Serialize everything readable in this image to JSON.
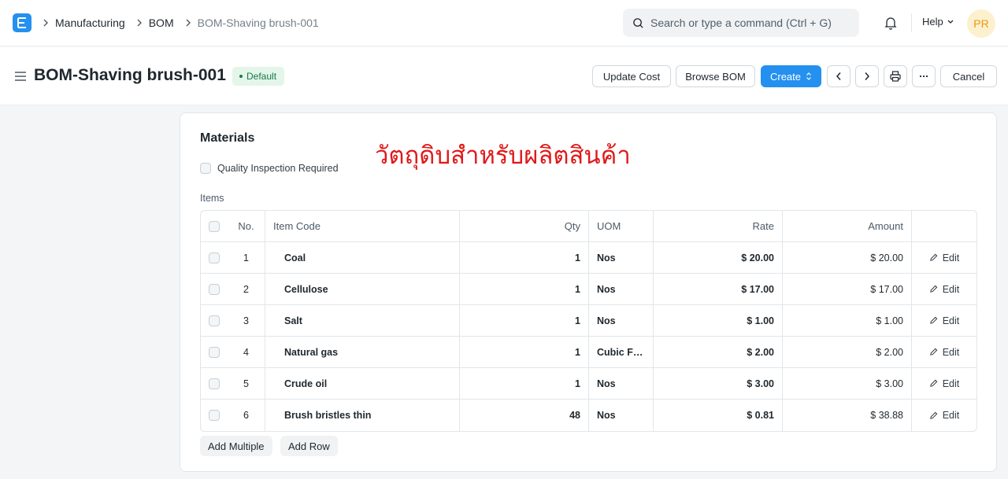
{
  "breadcrumbs": [
    "Manufacturing",
    "BOM",
    "BOM-Shaving brush-001"
  ],
  "search": {
    "placeholder": "Search or type a command (Ctrl + G)"
  },
  "help_label": "Help",
  "avatar_initials": "PR",
  "header": {
    "title": "BOM-Shaving brush-001",
    "status_badge": "Default",
    "buttons": {
      "update_cost": "Update Cost",
      "browse_bom": "Browse BOM",
      "create": "Create",
      "cancel": "Cancel"
    }
  },
  "materials": {
    "section_title": "Materials",
    "annotation": "วัตถุดิบสำหรับผลิตสินค้า",
    "quality_inspection_label": "Quality Inspection Required",
    "items_label": "Items",
    "columns": [
      "No.",
      "Item Code",
      "Qty",
      "UOM",
      "Rate",
      "Amount"
    ],
    "edit_label": "Edit",
    "rows": [
      {
        "no": "1",
        "item_code": "Coal",
        "qty": "1",
        "uom": "Nos",
        "rate": "$ 20.00",
        "amount": "$ 20.00"
      },
      {
        "no": "2",
        "item_code": "Cellulose",
        "qty": "1",
        "uom": "Nos",
        "rate": "$ 17.00",
        "amount": "$ 17.00"
      },
      {
        "no": "3",
        "item_code": "Salt",
        "qty": "1",
        "uom": "Nos",
        "rate": "$ 1.00",
        "amount": "$ 1.00"
      },
      {
        "no": "4",
        "item_code": "Natural gas",
        "qty": "1",
        "uom": "Cubic Fo...",
        "rate": "$ 2.00",
        "amount": "$ 2.00"
      },
      {
        "no": "5",
        "item_code": "Crude oil",
        "qty": "1",
        "uom": "Nos",
        "rate": "$ 3.00",
        "amount": "$ 3.00"
      },
      {
        "no": "6",
        "item_code": "Brush bristles thin",
        "qty": "48",
        "uom": "Nos",
        "rate": "$ 0.81",
        "amount": "$ 38.88"
      }
    ],
    "add_multiple_label": "Add Multiple",
    "add_row_label": "Add Row"
  },
  "colors": {
    "primary": "#2490ef",
    "annotation_red": "#e01919",
    "badge_green": "#16794c"
  }
}
